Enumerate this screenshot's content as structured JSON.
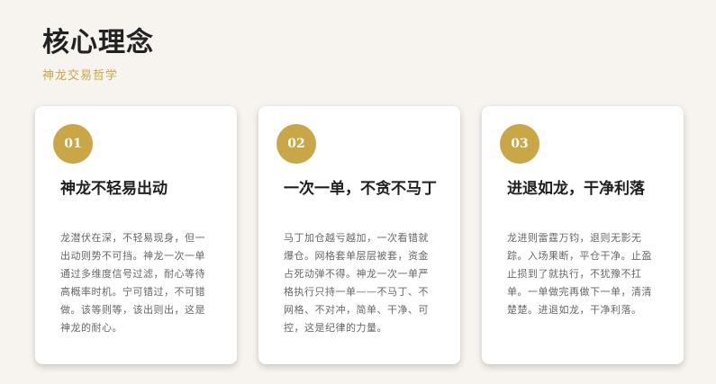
{
  "header": {
    "title": "核心理念",
    "subtitle": "神龙交易哲学"
  },
  "cards": [
    {
      "number": "01",
      "title": "神龙不轻易出动",
      "body": "龙潜伏在深，不轻易现身，但一出动则势不可挡。神龙一次一单通过多维度信号过滤，耐心等待高概率时机。宁可错过，不可错做。该等则等，该出则出，这是神龙的耐心。"
    },
    {
      "number": "02",
      "title": "一次一单，不贪不马丁",
      "body": "马丁加仓越亏越加，一次看错就爆仓。网格套单层层被套，资金占死动弹不得。神龙一次一单严格执行只持一单——不马丁、不网格、不对冲，简单、干净、可控，这是纪律的力量。"
    },
    {
      "number": "03",
      "title": "进退如龙，干净利落",
      "body": "龙进则雷霆万钧，退则无影无踪。入场果断，平仓干净。止盈止损到了就执行，不犹豫不扛单。一单做完再做下一单，清清楚楚。进退如龙，干净利落。"
    }
  ]
}
